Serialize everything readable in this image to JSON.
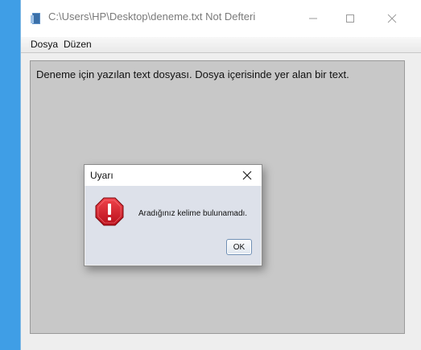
{
  "window": {
    "title": "C:\\Users\\HP\\Desktop\\deneme.txt Not Defteri",
    "icon": "notepad-icon"
  },
  "menubar": {
    "items": [
      "Dosya",
      "Düzen"
    ]
  },
  "editor": {
    "content": "Deneme için yazılan text dosyası. Dosya içerisinde yer alan bir text."
  },
  "dialog": {
    "title": "Uyarı",
    "message": "Aradığınız kelime bulunamadı.",
    "ok_label": "OK",
    "icon": "error-icon"
  },
  "colors": {
    "desktop": "#3f9ee6",
    "editor_bg": "#c8c8c8",
    "dialog_body": "#dde1ea",
    "error_red": "#d9232e"
  }
}
